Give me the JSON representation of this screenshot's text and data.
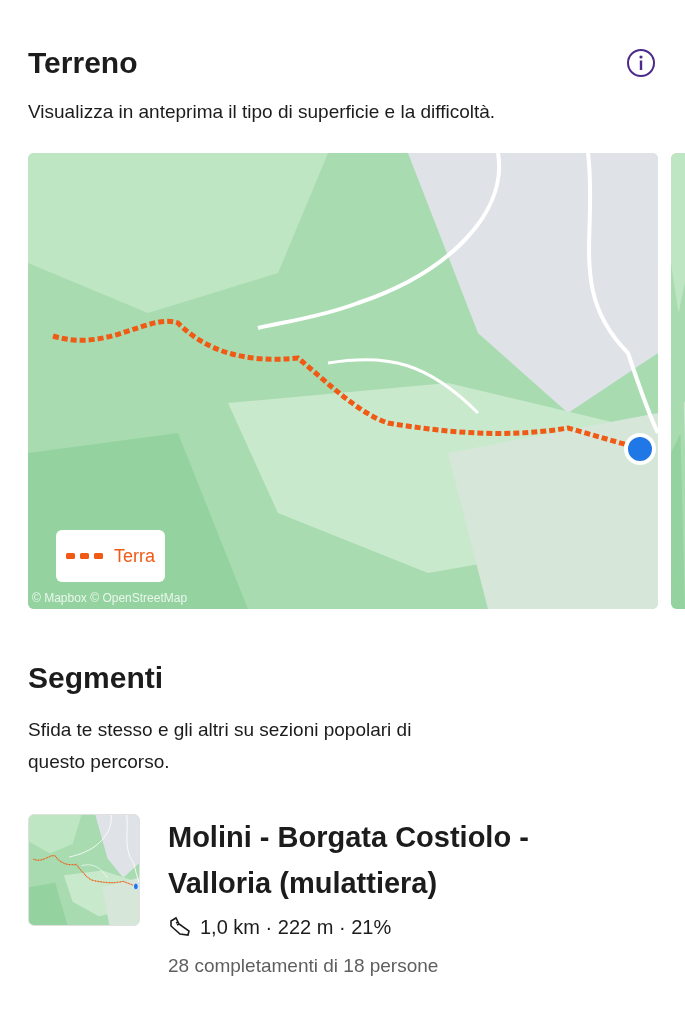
{
  "terrain": {
    "title": "Terreno",
    "description": "Visualizza in anteprima il tipo di superficie e la difficoltà.",
    "map": {
      "kind": "picture",
      "legend": "Terra",
      "attribution": "© Mapbox © OpenStreetMap"
    }
  },
  "segments": {
    "title": "Segmenti",
    "description": "Sfida te stesso e gli altri su sezioni popolari di questo percorso.",
    "items": [
      {
        "name": "Molini - Borgata Costiolo - Valloria (mulattiera)",
        "stats": "1,0 km · 222 m · 21%",
        "completions": "28 completamenti di 18 persone"
      }
    ]
  }
}
